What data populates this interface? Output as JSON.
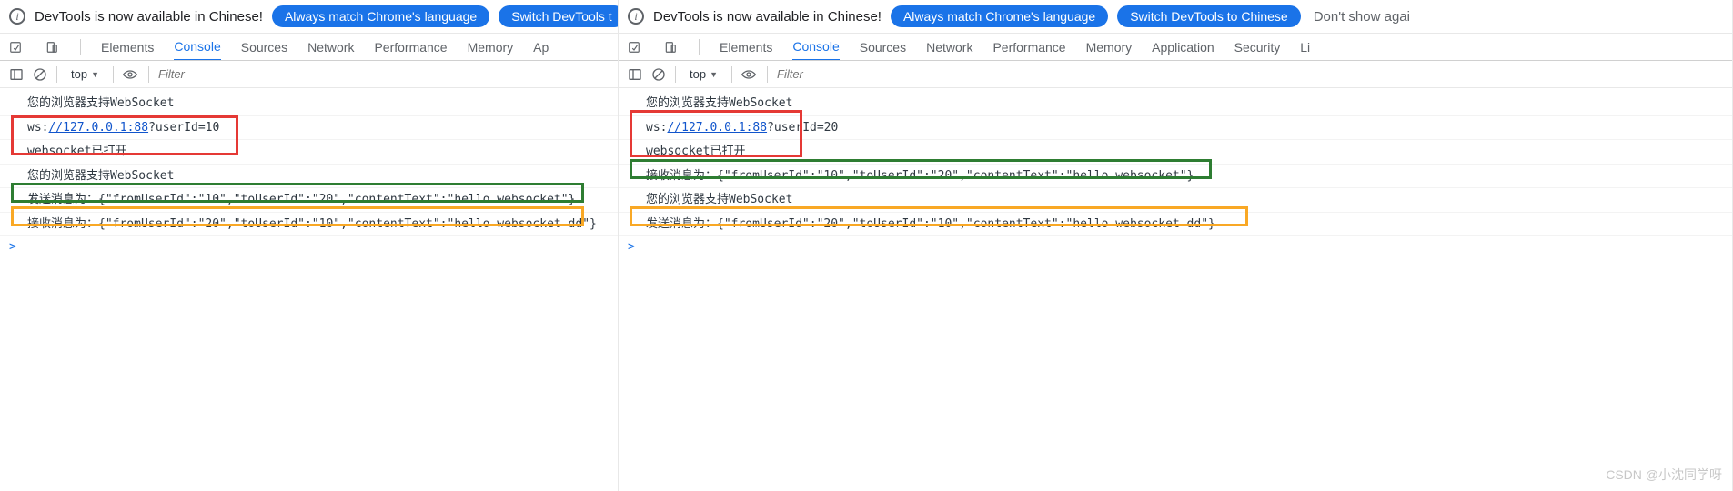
{
  "infobar": {
    "text": "DevTools is now available in Chinese!",
    "pill_match": "Always match Chrome's language",
    "pill_switch_full": "Switch DevTools to Chinese",
    "pill_switch_cut": "Switch DevTools t",
    "dont_show": "Don't show agai"
  },
  "tabs": {
    "elements": "Elements",
    "console": "Console",
    "sources": "Sources",
    "network": "Network",
    "performance": "Performance",
    "memory": "Memory",
    "application_full": "Application",
    "application_cut": "Ap",
    "security": "Security",
    "li": "Li"
  },
  "toolbar": {
    "context": "top",
    "filter_placeholder": "Filter"
  },
  "watermark": "CSDN @小沈同学呀",
  "left": {
    "log0": "您的浏览器支持WebSocket",
    "log1a": "ws:",
    "log1b": "//127.0.0.1:88",
    "log1c": "?userId=10",
    "log2": "websocket已打开",
    "log3": "您的浏览器支持WebSocket",
    "log4": "发送消息为：{\"fromUserId\":\"10\",\"toUserId\":\"20\",\"contentText\":\"hello websocket\"}",
    "log5": "接收消息为：{\"fromUserId\":\"20\",\"toUserId\":\"10\",\"contentText\":\"hello websocket dd\"}",
    "prompt": ">"
  },
  "right": {
    "log0": "您的浏览器支持WebSocket",
    "log1a": "ws:",
    "log1b": "//127.0.0.1:88",
    "log1c": "?userId=20",
    "log2": "websocket已打开",
    "log3": "接收消息为：{\"fromUserId\":\"10\",\"toUserId\":\"20\",\"contentText\":\"hello websocket\"}",
    "log4": "您的浏览器支持WebSocket",
    "log5": "发送消息为：{\"fromUserId\":\"20\",\"toUserId\":\"10\",\"contentText\":\"hello websocket dd\"}",
    "prompt": ">"
  }
}
